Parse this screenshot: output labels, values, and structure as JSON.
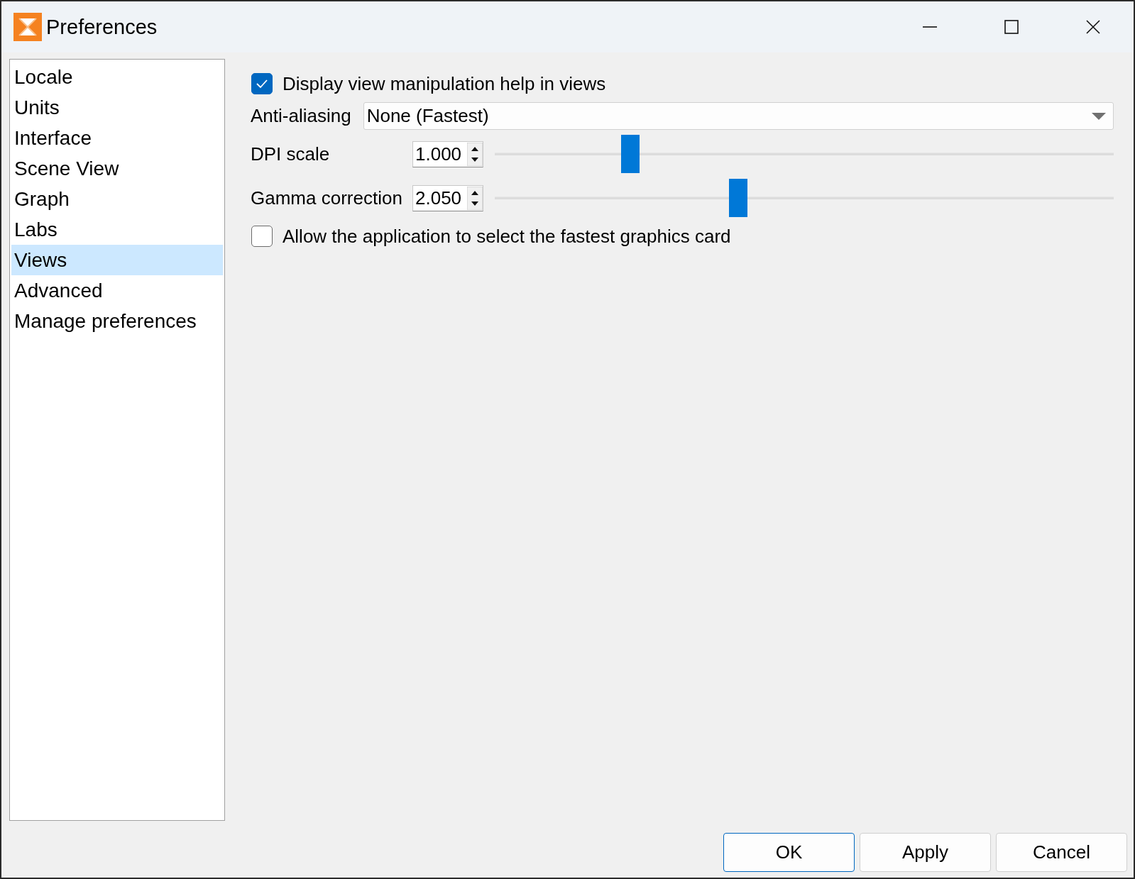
{
  "window": {
    "title": "Preferences"
  },
  "sidebar": {
    "items": [
      {
        "label": "Locale",
        "selected": false
      },
      {
        "label": "Units",
        "selected": false
      },
      {
        "label": "Interface",
        "selected": false
      },
      {
        "label": "Scene View",
        "selected": false
      },
      {
        "label": "Graph",
        "selected": false
      },
      {
        "label": "Labs",
        "selected": false
      },
      {
        "label": "Views",
        "selected": true
      },
      {
        "label": "Advanced",
        "selected": false
      },
      {
        "label": "Manage preferences",
        "selected": false
      }
    ]
  },
  "settings": [
    {
      "kind": "checkbox",
      "label": "Display view manipulation help in views",
      "checked": true
    },
    {
      "kind": "dropdown",
      "label": "Anti-aliasing",
      "value": "None (Fastest)"
    },
    {
      "kind": "spin_slider",
      "label": "DPI scale",
      "value": "1.000",
      "level": 0.21
    },
    {
      "kind": "spin_slider",
      "label": "Gamma correction",
      "value": "2.050",
      "level": 0.39
    },
    {
      "kind": "checkbox",
      "label": "Allow the application to select the fastest graphics card",
      "checked": false
    }
  ],
  "buttons": [
    {
      "label": "OK",
      "default": true
    },
    {
      "label": "Apply",
      "default": false
    },
    {
      "label": "Cancel",
      "default": false
    }
  ]
}
